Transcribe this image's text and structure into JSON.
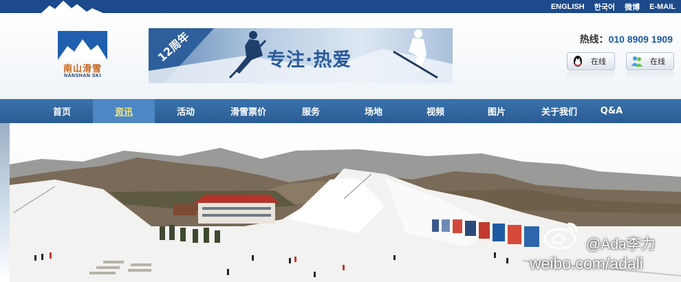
{
  "top_links": [
    "ENGLISH",
    "한국어",
    "微博",
    "E-MAIL"
  ],
  "logo": {
    "cn": "南山滑雪",
    "en": "NANSHAN SKI"
  },
  "banner": {
    "anniversary": "12周年",
    "slogan": "专注·热爱"
  },
  "hotline": {
    "label": "热线：",
    "number": "010 8909 1909"
  },
  "chat_buttons": [
    {
      "label": "在线",
      "icon": "qq-penguin-icon"
    },
    {
      "label": "在线",
      "icon": "msn-messenger-icon"
    }
  ],
  "nav": {
    "items": [
      "首页",
      "资讯",
      "活动",
      "滑雪票价",
      "服务",
      "场地",
      "视频",
      "图片",
      "关于我们",
      "Q&A"
    ],
    "active_index": 1
  },
  "watermark": {
    "handle": "@Ada李力",
    "url": "weibo.com/adali"
  },
  "colors": {
    "brand_blue": "#2a5c93",
    "active_text": "#f4e77c",
    "logo_orange": "#c8661a"
  }
}
